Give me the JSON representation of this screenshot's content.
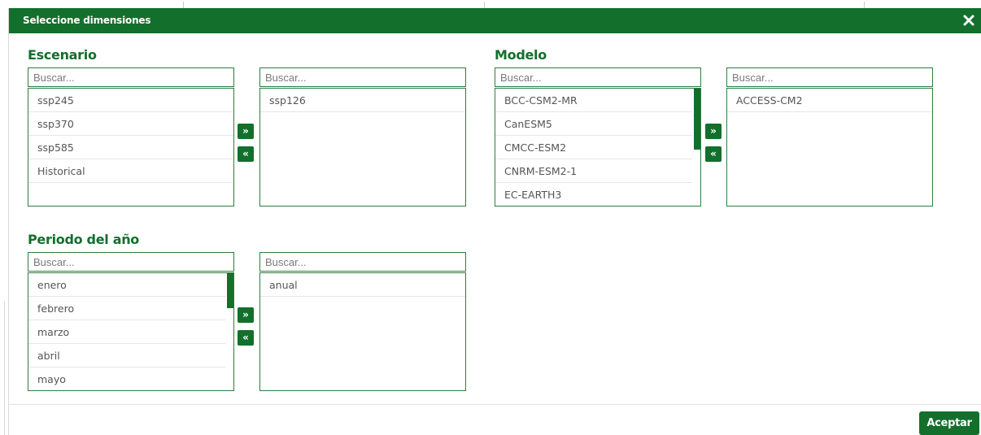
{
  "modal": {
    "title": "Seleccione dimensiones",
    "close_icon": "close-x-icon",
    "accept_label": "Aceptar"
  },
  "colors": {
    "primary": "#136f2c",
    "border": "#2f7d3f",
    "text": "#555555"
  },
  "sections": {
    "escenario": {
      "title": "Escenario",
      "available_search_placeholder": "Buscar...",
      "selected_search_placeholder": "Buscar...",
      "available": [
        "ssp245",
        "ssp370",
        "ssp585",
        "Historical"
      ],
      "selected": [
        "ssp126"
      ],
      "add_label": "»",
      "remove_label": "«"
    },
    "modelo": {
      "title": "Modelo",
      "available_search_placeholder": "Buscar...",
      "selected_search_placeholder": "Buscar...",
      "available": [
        "BCC-CSM2-MR",
        "CanESM5",
        "CMCC-ESM2",
        "CNRM-ESM2-1",
        "EC-EARTH3"
      ],
      "selected": [
        "ACCESS-CM2"
      ],
      "add_label": "»",
      "remove_label": "«"
    },
    "periodo": {
      "title": "Periodo del año",
      "available_search_placeholder": "Buscar...",
      "selected_search_placeholder": "Buscar...",
      "available": [
        "enero",
        "febrero",
        "marzo",
        "abril",
        "mayo"
      ],
      "selected": [
        "anual"
      ],
      "add_label": "»",
      "remove_label": "«"
    }
  }
}
